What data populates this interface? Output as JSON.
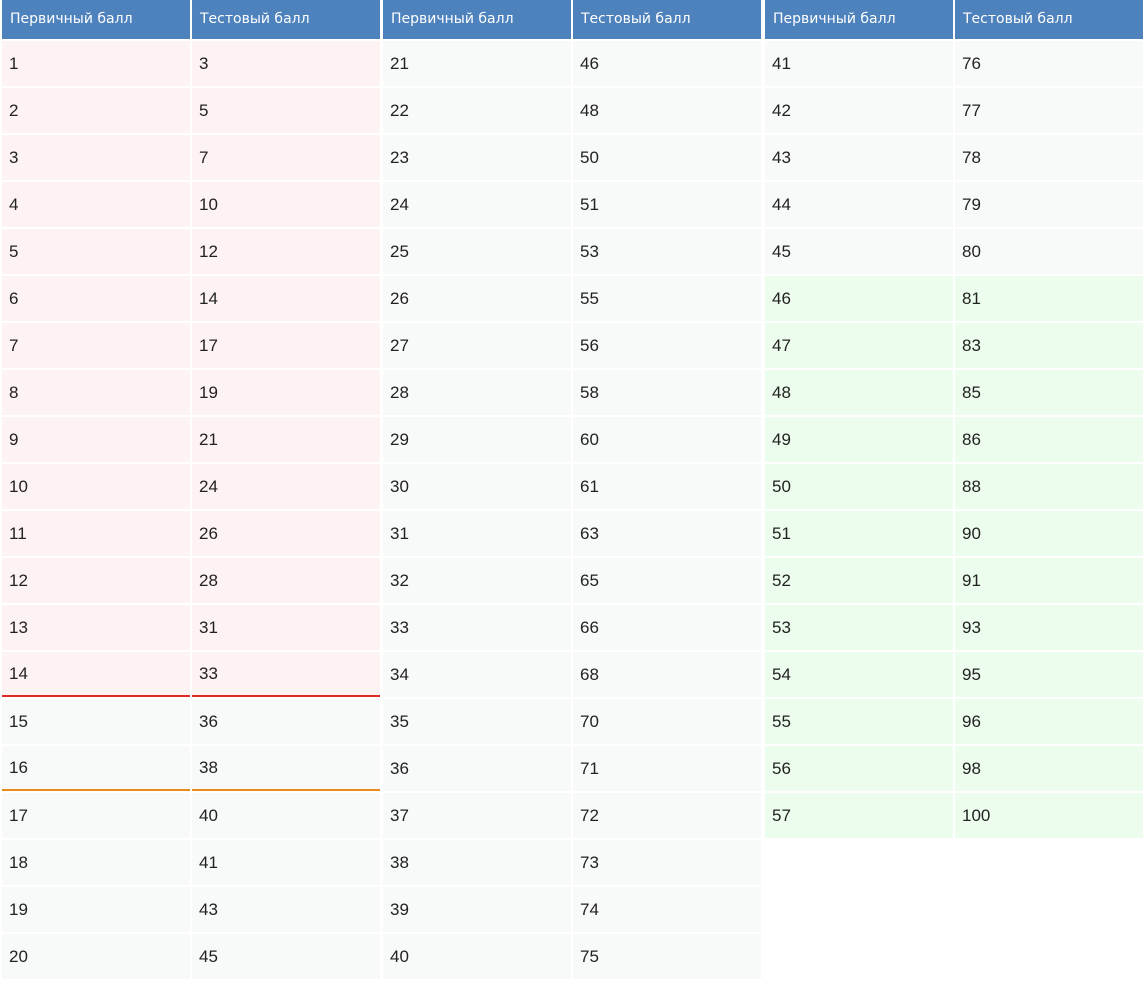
{
  "header": {
    "primary": "Первичный балл",
    "test": "Тестовый балл"
  },
  "tables": [
    {
      "rows": [
        [
          "1",
          "3",
          "r"
        ],
        [
          "2",
          "5",
          "r"
        ],
        [
          "3",
          "7",
          "r"
        ],
        [
          "4",
          "10",
          "r"
        ],
        [
          "5",
          "12",
          "r"
        ],
        [
          "6",
          "14",
          "r"
        ],
        [
          "7",
          "17",
          "r"
        ],
        [
          "8",
          "19",
          "r"
        ],
        [
          "9",
          "21",
          "r"
        ],
        [
          "10",
          "24",
          "r"
        ],
        [
          "11",
          "26",
          "r"
        ],
        [
          "12",
          "28",
          "r"
        ],
        [
          "13",
          "31",
          "r"
        ],
        [
          "14",
          "33",
          "r br"
        ],
        [
          "15",
          "36",
          ""
        ],
        [
          "16",
          "38",
          "bo"
        ],
        [
          "17",
          "40",
          ""
        ],
        [
          "18",
          "41",
          ""
        ],
        [
          "19",
          "43",
          ""
        ],
        [
          "20",
          "45",
          ""
        ]
      ]
    },
    {
      "rows": [
        [
          "21",
          "46",
          ""
        ],
        [
          "22",
          "48",
          ""
        ],
        [
          "23",
          "50",
          ""
        ],
        [
          "24",
          "51",
          ""
        ],
        [
          "25",
          "53",
          ""
        ],
        [
          "26",
          "55",
          ""
        ],
        [
          "27",
          "56",
          ""
        ],
        [
          "28",
          "58",
          ""
        ],
        [
          "29",
          "60",
          ""
        ],
        [
          "30",
          "61",
          ""
        ],
        [
          "31",
          "63",
          ""
        ],
        [
          "32",
          "65",
          ""
        ],
        [
          "33",
          "66",
          ""
        ],
        [
          "34",
          "68",
          ""
        ],
        [
          "35",
          "70",
          ""
        ],
        [
          "36",
          "71",
          ""
        ],
        [
          "37",
          "72",
          ""
        ],
        [
          "38",
          "73",
          ""
        ],
        [
          "39",
          "74",
          ""
        ],
        [
          "40",
          "75",
          ""
        ]
      ]
    },
    {
      "rows": [
        [
          "41",
          "76",
          ""
        ],
        [
          "42",
          "77",
          ""
        ],
        [
          "43",
          "78",
          ""
        ],
        [
          "44",
          "79",
          ""
        ],
        [
          "45",
          "80",
          ""
        ],
        [
          "46",
          "81",
          "g"
        ],
        [
          "47",
          "83",
          "g"
        ],
        [
          "48",
          "85",
          "g"
        ],
        [
          "49",
          "86",
          "g"
        ],
        [
          "50",
          "88",
          "g"
        ],
        [
          "51",
          "90",
          "g"
        ],
        [
          "52",
          "91",
          "g"
        ],
        [
          "53",
          "93",
          "g"
        ],
        [
          "54",
          "95",
          "g"
        ],
        [
          "55",
          "96",
          "g"
        ],
        [
          "56",
          "98",
          "g"
        ],
        [
          "57",
          "100",
          "g"
        ]
      ]
    }
  ],
  "colors": {
    "header_bg": "#4d82bd",
    "low_zone_bg": "#fdf3f2",
    "high_zone_bg": "#ecfced",
    "threshold_red": "#e02b20",
    "threshold_orange": "#e98a1c"
  }
}
